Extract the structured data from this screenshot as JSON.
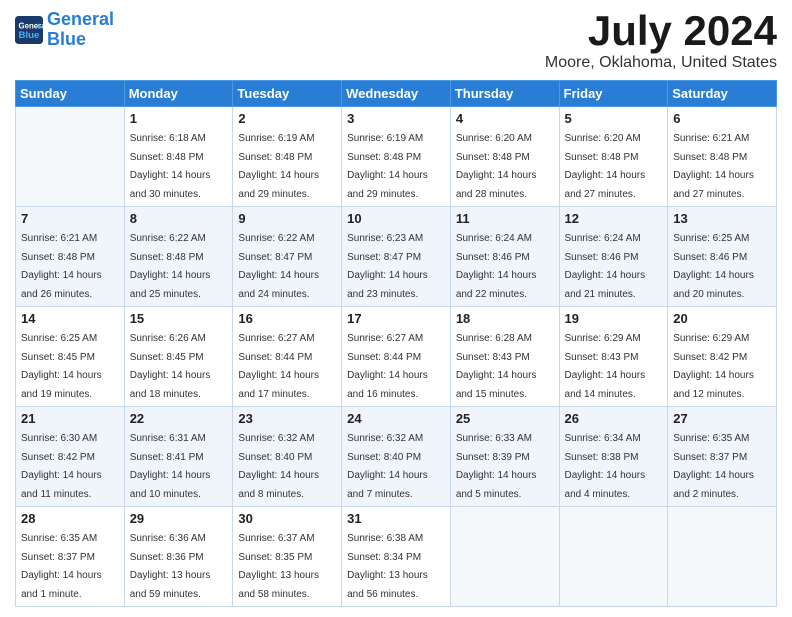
{
  "header": {
    "logo_line1": "General",
    "logo_line2": "Blue",
    "month_title": "July 2024",
    "location": "Moore, Oklahoma, United States"
  },
  "days_of_week": [
    "Sunday",
    "Monday",
    "Tuesday",
    "Wednesday",
    "Thursday",
    "Friday",
    "Saturday"
  ],
  "weeks": [
    [
      {
        "num": "",
        "empty": true
      },
      {
        "num": "1",
        "sunrise": "6:18 AM",
        "sunset": "8:48 PM",
        "daylight": "14 hours and 30 minutes."
      },
      {
        "num": "2",
        "sunrise": "6:19 AM",
        "sunset": "8:48 PM",
        "daylight": "14 hours and 29 minutes."
      },
      {
        "num": "3",
        "sunrise": "6:19 AM",
        "sunset": "8:48 PM",
        "daylight": "14 hours and 29 minutes."
      },
      {
        "num": "4",
        "sunrise": "6:20 AM",
        "sunset": "8:48 PM",
        "daylight": "14 hours and 28 minutes."
      },
      {
        "num": "5",
        "sunrise": "6:20 AM",
        "sunset": "8:48 PM",
        "daylight": "14 hours and 27 minutes."
      },
      {
        "num": "6",
        "sunrise": "6:21 AM",
        "sunset": "8:48 PM",
        "daylight": "14 hours and 27 minutes."
      }
    ],
    [
      {
        "num": "7",
        "sunrise": "6:21 AM",
        "sunset": "8:48 PM",
        "daylight": "14 hours and 26 minutes."
      },
      {
        "num": "8",
        "sunrise": "6:22 AM",
        "sunset": "8:48 PM",
        "daylight": "14 hours and 25 minutes."
      },
      {
        "num": "9",
        "sunrise": "6:22 AM",
        "sunset": "8:47 PM",
        "daylight": "14 hours and 24 minutes."
      },
      {
        "num": "10",
        "sunrise": "6:23 AM",
        "sunset": "8:47 PM",
        "daylight": "14 hours and 23 minutes."
      },
      {
        "num": "11",
        "sunrise": "6:24 AM",
        "sunset": "8:46 PM",
        "daylight": "14 hours and 22 minutes."
      },
      {
        "num": "12",
        "sunrise": "6:24 AM",
        "sunset": "8:46 PM",
        "daylight": "14 hours and 21 minutes."
      },
      {
        "num": "13",
        "sunrise": "6:25 AM",
        "sunset": "8:46 PM",
        "daylight": "14 hours and 20 minutes."
      }
    ],
    [
      {
        "num": "14",
        "sunrise": "6:25 AM",
        "sunset": "8:45 PM",
        "daylight": "14 hours and 19 minutes."
      },
      {
        "num": "15",
        "sunrise": "6:26 AM",
        "sunset": "8:45 PM",
        "daylight": "14 hours and 18 minutes."
      },
      {
        "num": "16",
        "sunrise": "6:27 AM",
        "sunset": "8:44 PM",
        "daylight": "14 hours and 17 minutes."
      },
      {
        "num": "17",
        "sunrise": "6:27 AM",
        "sunset": "8:44 PM",
        "daylight": "14 hours and 16 minutes."
      },
      {
        "num": "18",
        "sunrise": "6:28 AM",
        "sunset": "8:43 PM",
        "daylight": "14 hours and 15 minutes."
      },
      {
        "num": "19",
        "sunrise": "6:29 AM",
        "sunset": "8:43 PM",
        "daylight": "14 hours and 14 minutes."
      },
      {
        "num": "20",
        "sunrise": "6:29 AM",
        "sunset": "8:42 PM",
        "daylight": "14 hours and 12 minutes."
      }
    ],
    [
      {
        "num": "21",
        "sunrise": "6:30 AM",
        "sunset": "8:42 PM",
        "daylight": "14 hours and 11 minutes."
      },
      {
        "num": "22",
        "sunrise": "6:31 AM",
        "sunset": "8:41 PM",
        "daylight": "14 hours and 10 minutes."
      },
      {
        "num": "23",
        "sunrise": "6:32 AM",
        "sunset": "8:40 PM",
        "daylight": "14 hours and 8 minutes."
      },
      {
        "num": "24",
        "sunrise": "6:32 AM",
        "sunset": "8:40 PM",
        "daylight": "14 hours and 7 minutes."
      },
      {
        "num": "25",
        "sunrise": "6:33 AM",
        "sunset": "8:39 PM",
        "daylight": "14 hours and 5 minutes."
      },
      {
        "num": "26",
        "sunrise": "6:34 AM",
        "sunset": "8:38 PM",
        "daylight": "14 hours and 4 minutes."
      },
      {
        "num": "27",
        "sunrise": "6:35 AM",
        "sunset": "8:37 PM",
        "daylight": "14 hours and 2 minutes."
      }
    ],
    [
      {
        "num": "28",
        "sunrise": "6:35 AM",
        "sunset": "8:37 PM",
        "daylight": "14 hours and 1 minute."
      },
      {
        "num": "29",
        "sunrise": "6:36 AM",
        "sunset": "8:36 PM",
        "daylight": "13 hours and 59 minutes."
      },
      {
        "num": "30",
        "sunrise": "6:37 AM",
        "sunset": "8:35 PM",
        "daylight": "13 hours and 58 minutes."
      },
      {
        "num": "31",
        "sunrise": "6:38 AM",
        "sunset": "8:34 PM",
        "daylight": "13 hours and 56 minutes."
      },
      {
        "num": "",
        "empty": true
      },
      {
        "num": "",
        "empty": true
      },
      {
        "num": "",
        "empty": true
      }
    ]
  ]
}
